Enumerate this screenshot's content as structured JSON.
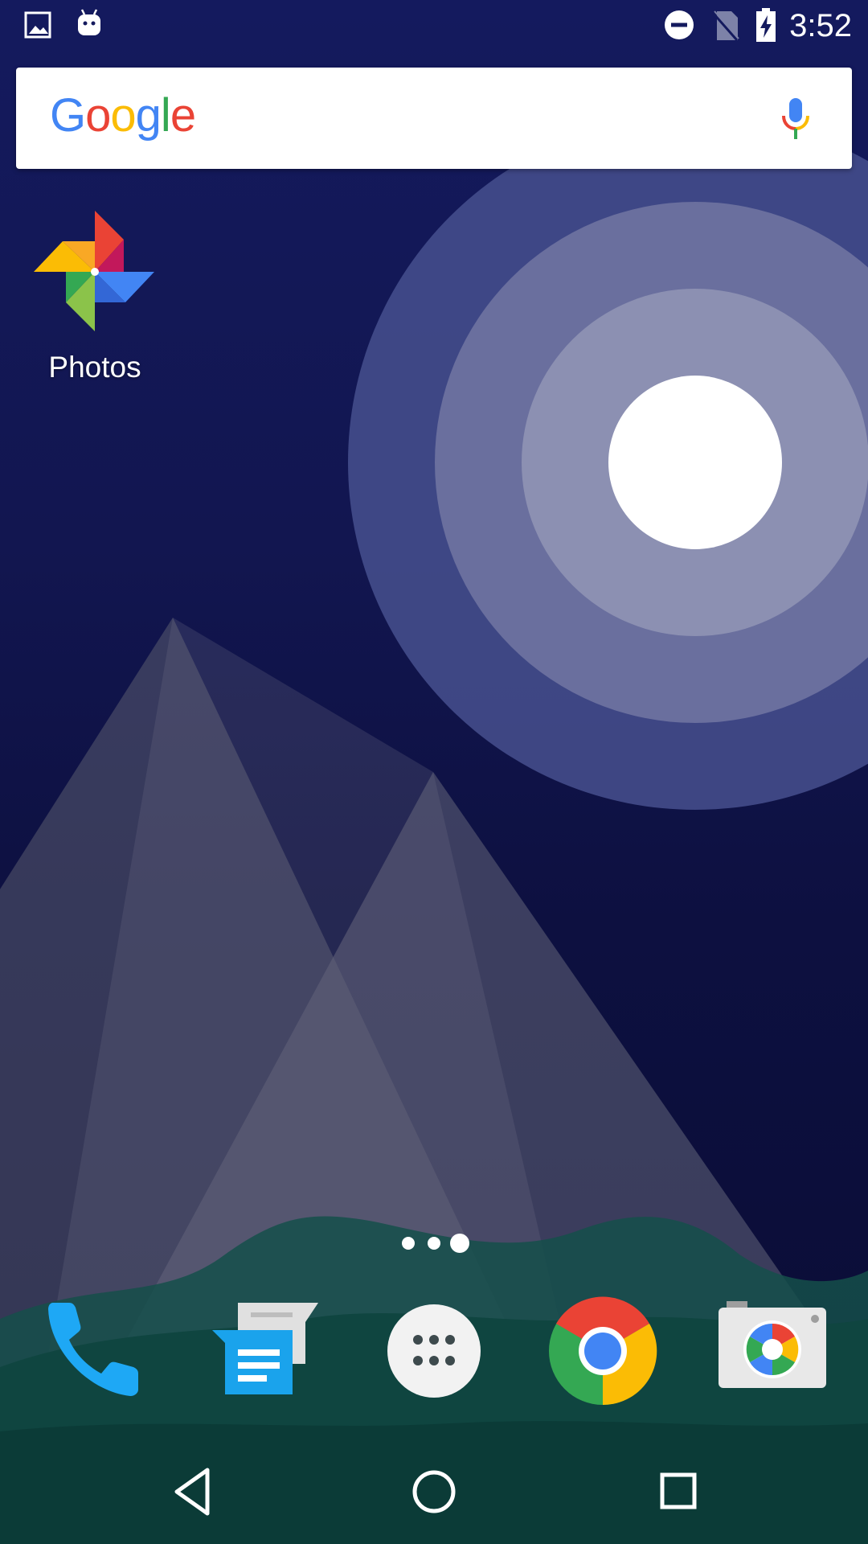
{
  "status_bar": {
    "time": "3:52",
    "left_icons": [
      "gallery-notification-icon",
      "android-notification-icon"
    ],
    "right_icons": [
      "do-not-disturb-icon",
      "no-sim-icon",
      "battery-charging-icon"
    ]
  },
  "search": {
    "logo_letters": [
      "G",
      "o",
      "o",
      "g",
      "l",
      "e"
    ],
    "logo_colors": [
      "#4285F4",
      "#EA4335",
      "#FBBC05",
      "#4285F4",
      "#34A853",
      "#EA4335"
    ],
    "mic_icon": "mic-icon"
  },
  "home_apps": [
    {
      "label": "Photos",
      "icon": "photos-pinwheel-icon"
    }
  ],
  "page_indicator": {
    "pages": 3,
    "current": 3
  },
  "dock": [
    {
      "name": "phone",
      "icon": "phone-icon"
    },
    {
      "name": "messages",
      "icon": "messages-icon"
    },
    {
      "name": "app-drawer",
      "icon": "app-drawer-icon"
    },
    {
      "name": "chrome",
      "icon": "chrome-icon"
    },
    {
      "name": "camera",
      "icon": "camera-icon"
    }
  ],
  "nav": {
    "back_icon": "back-triangle-icon",
    "home_icon": "home-circle-icon",
    "recents_icon": "recents-square-icon"
  },
  "colors": {
    "wallpaper_top": "#141a5e",
    "wallpaper_bottom": "#0a0c34",
    "hills": "#0f4a44",
    "phone_blue": "#1ea8f5",
    "messages_blue": "#1aa3ec"
  }
}
